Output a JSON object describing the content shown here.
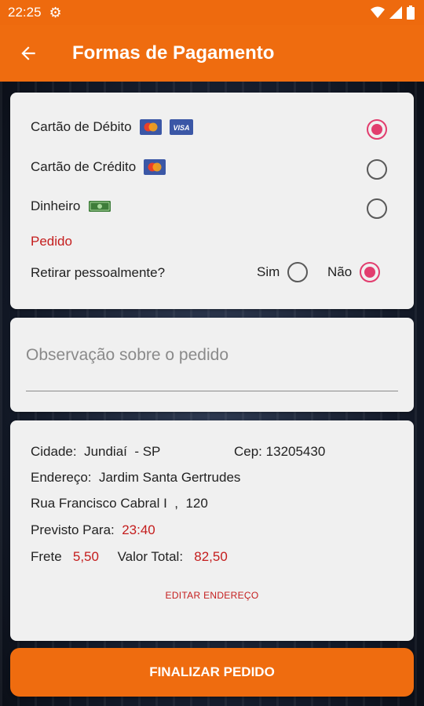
{
  "status_bar": {
    "time": "22:25"
  },
  "app_bar": {
    "title": "Formas de Pagamento"
  },
  "payment": {
    "options": [
      {
        "label": "Cartão de Débito",
        "selected": true
      },
      {
        "label": "Cartão de Crédito",
        "selected": false
      },
      {
        "label": "Dinheiro",
        "selected": false
      }
    ],
    "section_label": "Pedido",
    "pickup_question": "Retirar pessoalmente?",
    "pickup_yes": "Sim",
    "pickup_no": "Não",
    "pickup_selected": "Não",
    "visa_text": "VISA"
  },
  "observation": {
    "placeholder": "Observação sobre o pedido",
    "value": ""
  },
  "address": {
    "city_label": "Cidade:",
    "city_value": "Jundiaí  - SP",
    "cep_label": "Cep:",
    "cep_value": "13205430",
    "address_label": "Endereço:",
    "address_value": "Jardim Santa Gertrudes",
    "street_line": "Rua Francisco Cabral I  ,  120",
    "forecast_label": "Previsto Para:",
    "forecast_value": "23:40",
    "shipping_label": "Frete",
    "shipping_value": "5,50",
    "total_label": "Valor Total:",
    "total_value": "82,50",
    "edit_link": "EDITAR ENDEREÇO"
  },
  "actions": {
    "finalize": "FINALIZAR PEDIDO"
  },
  "colors": {
    "primary": "#ef6c0f",
    "radio_accent": "#e23d6e",
    "highlight_red": "#c41d1d"
  }
}
